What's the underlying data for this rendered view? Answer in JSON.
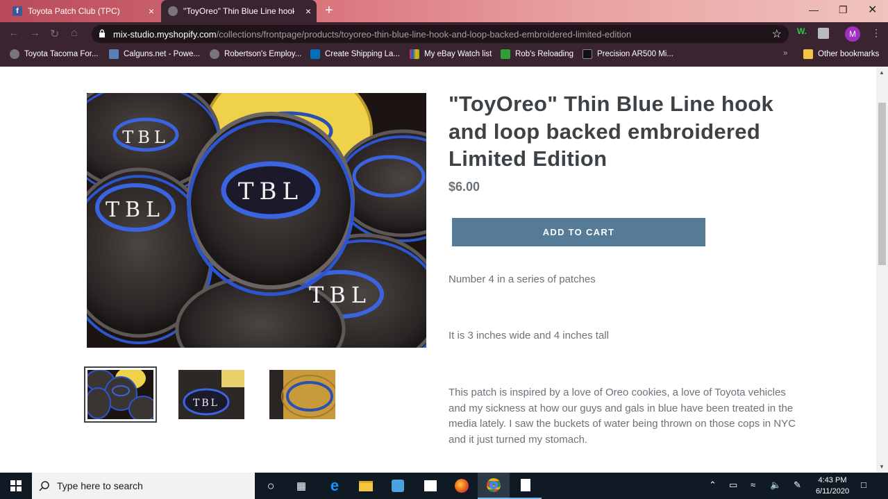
{
  "browser": {
    "tabs": [
      {
        "title": "Toyota Patch Club (TPC)",
        "active": false
      },
      {
        "title": "\"ToyOreo\" Thin Blue Line hook and loop backed embroidered Limited Edition",
        "active": true
      }
    ],
    "new_tab": "+",
    "close_glyph": "×",
    "url_host": "mix-studio.myshopify.com",
    "url_path": "/collections/frontpage/products/toyoreo-thin-blue-line-hook-and-loop-backed-embroidered-limited-edition",
    "profile_initial": "M",
    "ext_label": "W.",
    "bookmarks": [
      "Toyota Tacoma For...",
      "Calguns.net - Powe...",
      "Robertson's Employ...",
      "Create Shipping La...",
      "My eBay Watch list",
      "Rob's Reloading",
      "Precision AR500 Mi..."
    ],
    "bookmark_overflow": "»",
    "other_bookmarks": "Other bookmarks"
  },
  "product": {
    "title": "\"ToyOreo\" Thin Blue Line hook and loop backed embroidered Limited Edition",
    "price": "$6.00",
    "add_to_cart": "ADD TO CART",
    "description": [
      "Number 4 in a series of patches",
      "It is 3 inches wide and 4 inches tall",
      "This patch is inspired by a love of Oreo cookies, a love of Toyota vehicles and my sickness at how our guys and gals in blue have been treated in the media lately.  I saw the buckets of water being thrown on those cops in NYC and it just turned my stomach."
    ],
    "patch_text": "TBL",
    "colors": {
      "accent": "#557b97",
      "title": "#3d4246",
      "body": "#69727b"
    }
  },
  "taskbar": {
    "search_placeholder": "Type here to search",
    "time": "4:43 PM",
    "date": "6/11/2020"
  }
}
